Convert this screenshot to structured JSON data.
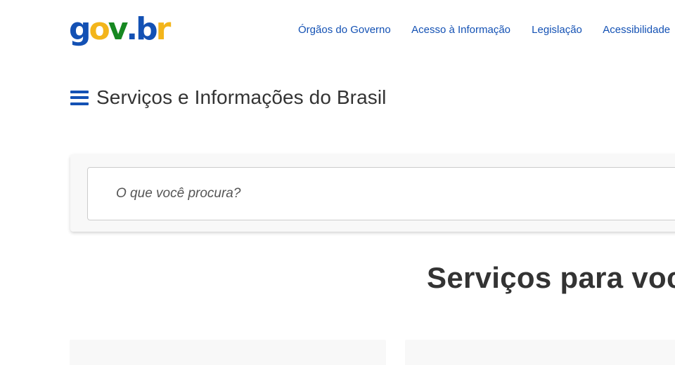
{
  "header": {
    "logo": {
      "letters": [
        {
          "char": "g",
          "color": "#1351b4"
        },
        {
          "char": "o",
          "color": "#f3b51b"
        },
        {
          "char": "v",
          "color": "#168821"
        },
        {
          "char": ".",
          "color": "#1351b4"
        },
        {
          "char": "b",
          "color": "#1351b4"
        },
        {
          "char": "r",
          "color": "#f3b51b"
        }
      ]
    },
    "nav": {
      "items": [
        {
          "label": "Órgãos do Governo"
        },
        {
          "label": "Acesso à Informação"
        },
        {
          "label": "Legislação"
        },
        {
          "label": "Acessibilidade"
        }
      ]
    }
  },
  "site": {
    "menu_icon": "hamburger-menu-icon",
    "title": "Serviços e Informações do Brasil"
  },
  "search": {
    "placeholder": "O que você procura?",
    "value": ""
  },
  "main": {
    "heading": "Serviços para você"
  },
  "colors": {
    "accent": "#1351b4",
    "text": "#333333",
    "panel": "#f8f8f8",
    "logo_yellow": "#f3b51b",
    "logo_green": "#168821"
  }
}
